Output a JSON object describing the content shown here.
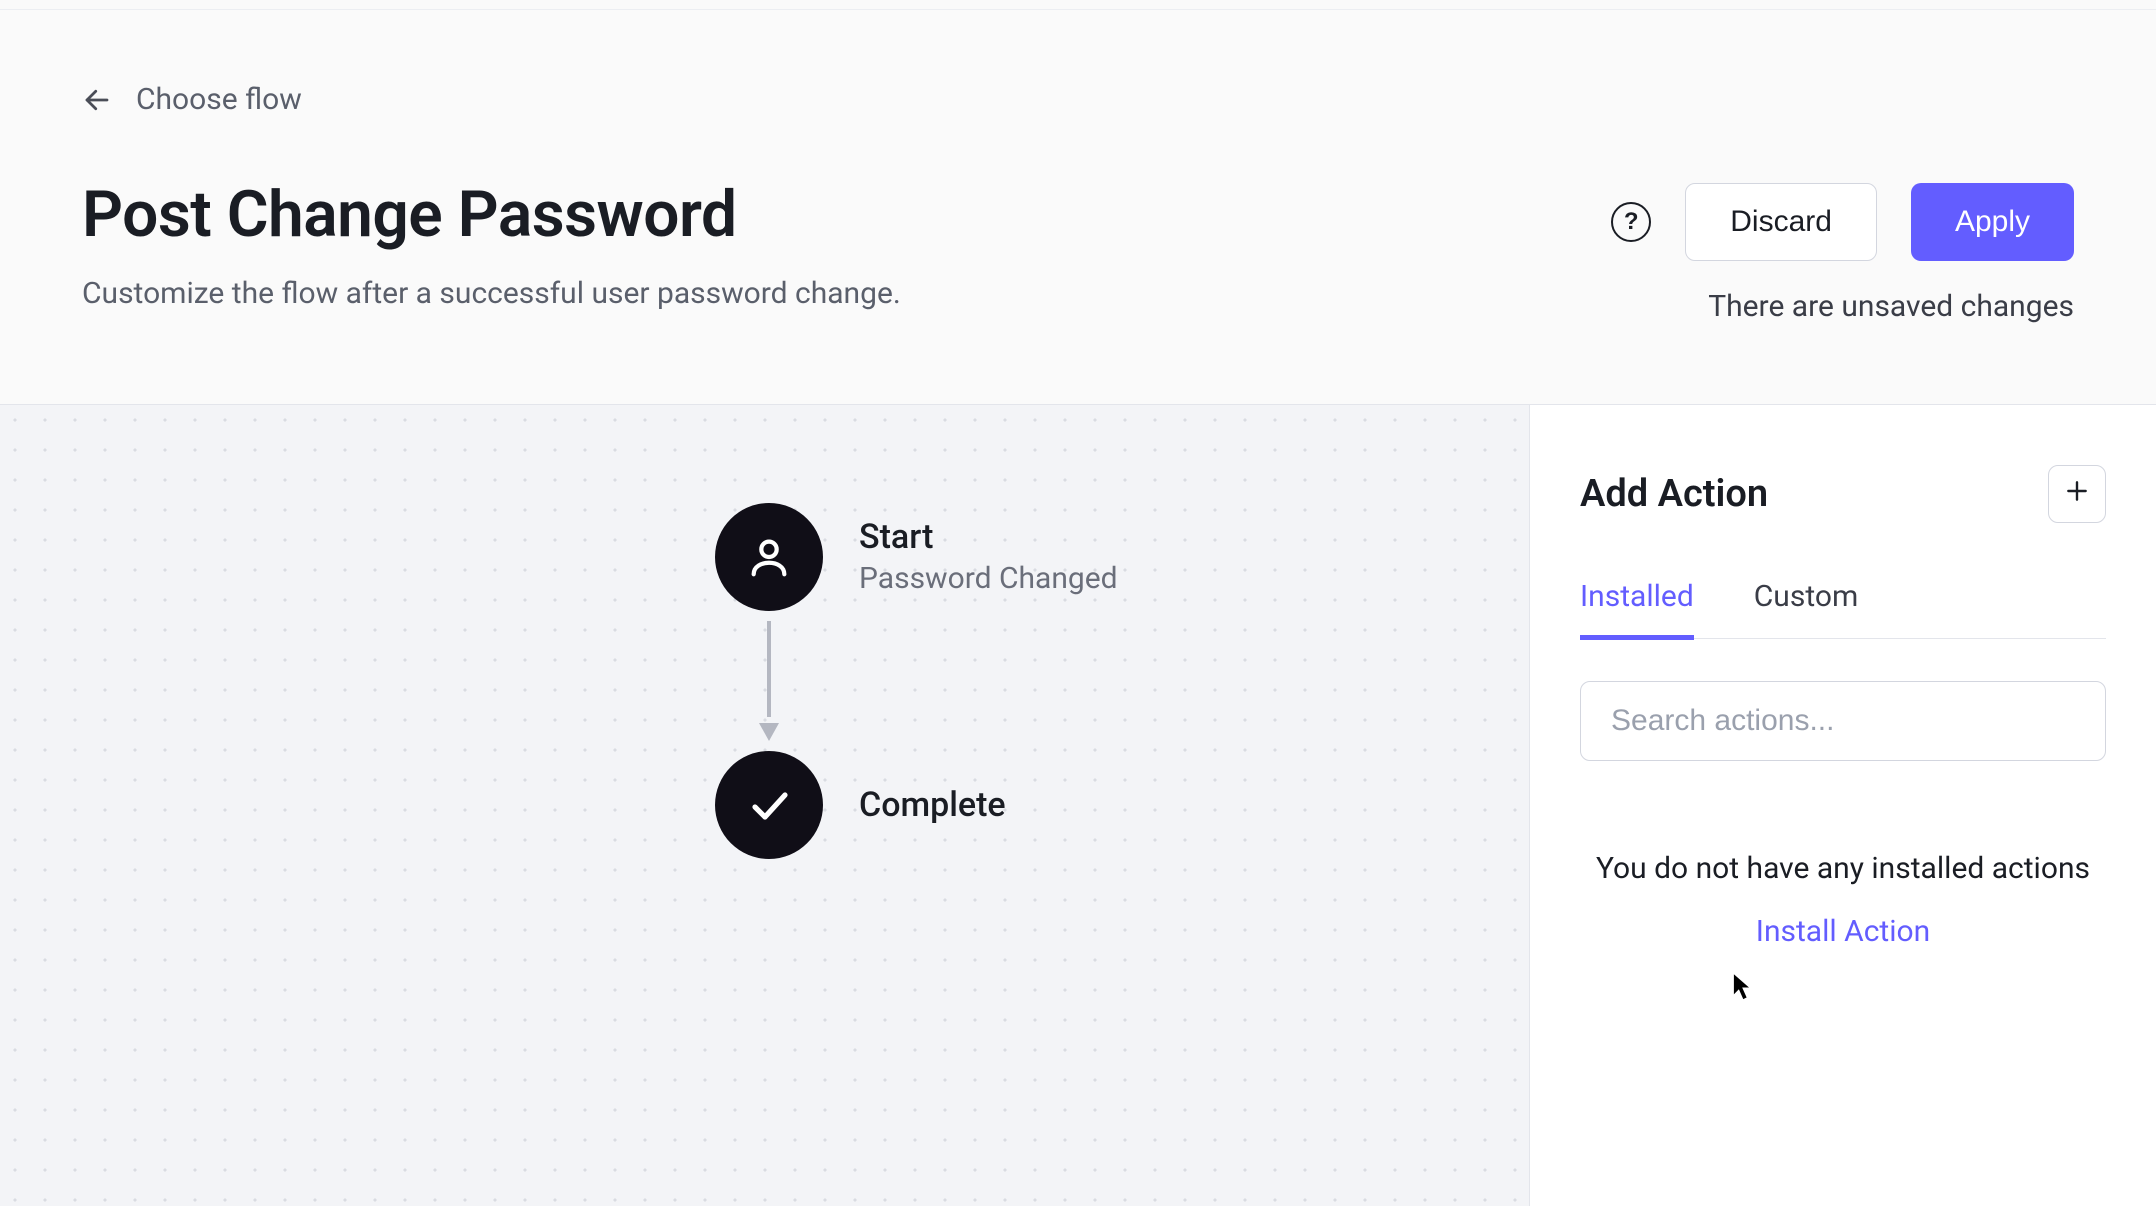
{
  "breadcrumb": {
    "label": "Choose flow"
  },
  "page": {
    "title": "Post Change Password",
    "subtitle": "Customize the flow after a successful user password change."
  },
  "headerActions": {
    "helpTooltip": "?",
    "discard": "Discard",
    "apply": "Apply",
    "unsavedNote": "There are unsaved changes"
  },
  "flow": {
    "start": {
      "title": "Start",
      "subtitle": "Password Changed"
    },
    "complete": {
      "title": "Complete"
    }
  },
  "sidebar": {
    "title": "Add Action",
    "tabs": {
      "installed": "Installed",
      "custom": "Custom"
    },
    "searchPlaceholder": "Search actions...",
    "empty": {
      "message": "You do not have any installed actions",
      "link": "Install Action"
    }
  },
  "colors": {
    "accent": "#635dff"
  }
}
